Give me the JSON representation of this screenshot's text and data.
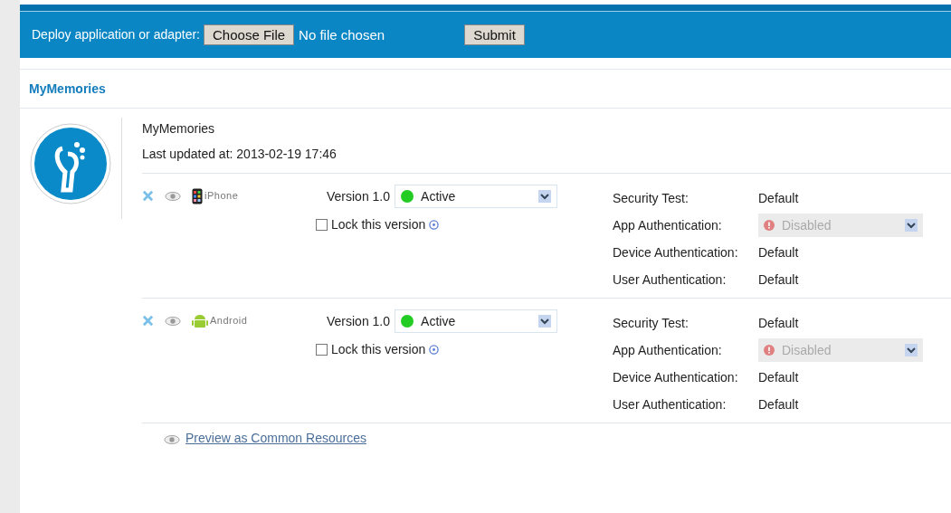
{
  "deploy_bar": {
    "label": "Deploy application or adapter:",
    "choose_button": "Choose File",
    "file_status": "No file chosen",
    "submit_button": "Submit"
  },
  "section_title": "MyMemories",
  "app": {
    "name": "MyMemories",
    "last_updated": "Last updated at: 2013-02-19 17:46"
  },
  "environments": [
    {
      "kind": "iphone",
      "name": "iPhone",
      "version": "Version 1.0",
      "status": {
        "label": "Active",
        "color": "#22cc22"
      },
      "lock": {
        "label": "Lock this version",
        "checked": false
      },
      "security": [
        {
          "label": "Security Test:",
          "value": "Default",
          "kind": "text"
        },
        {
          "label": "App Authentication:",
          "value": "Disabled",
          "kind": "select",
          "disabled": true
        },
        {
          "label": "Device Authentication:",
          "value": "Default",
          "kind": "text"
        },
        {
          "label": "User Authentication:",
          "value": "Default",
          "kind": "text"
        }
      ]
    },
    {
      "kind": "android",
      "name": "Android",
      "version": "Version 1.0",
      "status": {
        "label": "Active",
        "color": "#22cc22"
      },
      "lock": {
        "label": "Lock this version",
        "checked": false
      },
      "security": [
        {
          "label": "Security Test:",
          "value": "Default",
          "kind": "text"
        },
        {
          "label": "App Authentication:",
          "value": "Disabled",
          "kind": "select",
          "disabled": true
        },
        {
          "label": "Device Authentication:",
          "value": "Default",
          "kind": "text"
        },
        {
          "label": "User Authentication:",
          "value": "Default",
          "kind": "text"
        }
      ]
    }
  ],
  "preview_link": "Preview as Common Resources"
}
